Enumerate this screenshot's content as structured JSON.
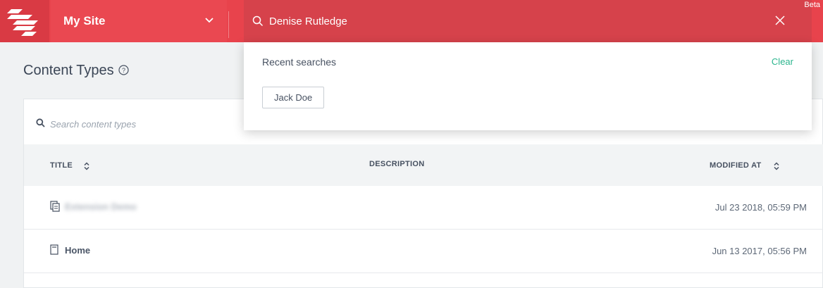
{
  "header": {
    "site_name": "My Site",
    "search_value": "Denise Rutledge",
    "beta_label": "Beta"
  },
  "page": {
    "title": "Content Types"
  },
  "panel": {
    "search_placeholder": "Search content types",
    "columns": [
      "TITLE",
      "DESCRIPTION",
      "MODIFIED AT"
    ],
    "rows": [
      {
        "title": "Extension Demo",
        "modified": "Jul 23 2018, 05:59 PM"
      },
      {
        "title": "Home",
        "modified": "Jun 13 2017, 05:56 PM"
      }
    ]
  },
  "dropdown": {
    "title": "Recent searches",
    "clear_label": "Clear",
    "recent": [
      "Jack Doe"
    ]
  },
  "colors": {
    "brand": "#e8434c",
    "accent_green": "#2bb58e"
  }
}
